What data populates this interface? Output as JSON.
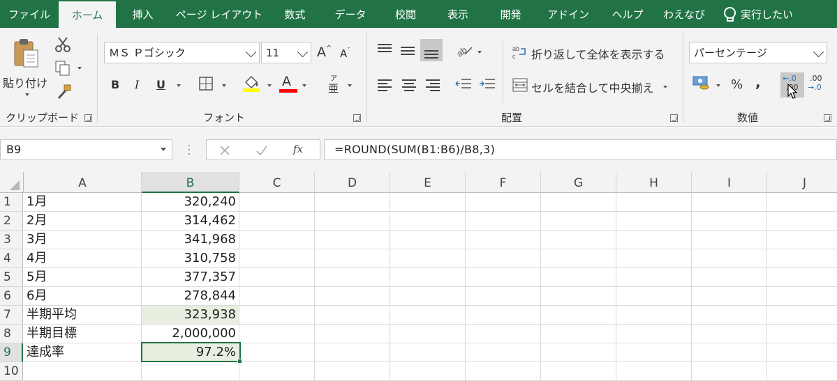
{
  "tabs": [
    {
      "label": "ファイル",
      "active": false
    },
    {
      "label": "ホーム",
      "active": true
    },
    {
      "label": "挿入",
      "active": false
    },
    {
      "label": "ページ レイアウト",
      "active": false
    },
    {
      "label": "数式",
      "active": false
    },
    {
      "label": "データ",
      "active": false
    },
    {
      "label": "校閲",
      "active": false
    },
    {
      "label": "表示",
      "active": false
    },
    {
      "label": "開発",
      "active": false
    },
    {
      "label": "アドイン",
      "active": false
    },
    {
      "label": "ヘルプ",
      "active": false
    },
    {
      "label": "わえなび",
      "active": false
    }
  ],
  "tell_me": "実行したい",
  "ribbon": {
    "clipboard": {
      "paste_label": "貼り付け",
      "group_label": "クリップボード"
    },
    "font": {
      "font_name": "ＭＳ Ｐゴシック",
      "font_size": "11",
      "grow_label": "A",
      "shrink_label": "A",
      "bold": "B",
      "italic": "I",
      "underline": "U",
      "font_color_letter": "A",
      "font_color": "#ff0000",
      "phonetic_top": "ア",
      "phonetic_bottom": "亜",
      "group_label": "フォント"
    },
    "alignment": {
      "wrap_text": "折り返して全体を表示する",
      "merge_center": "セルを結合して中央揃え",
      "group_label": "配置"
    },
    "number": {
      "format": "パーセンテージ",
      "percent": "%",
      "comma": ",",
      "increase_decimal_top": "←.0",
      "increase_decimal_bottom": ".00",
      "decrease_decimal_top": ".00",
      "decrease_decimal_bottom": "→.0",
      "group_label": "数値"
    }
  },
  "formula_bar": {
    "name_box": "B9",
    "fx": "fx",
    "formula": "=ROUND(SUM(B1:B6)/B8,3)"
  },
  "columns": [
    "A",
    "B",
    "C",
    "D",
    "E",
    "F",
    "G",
    "H",
    "I",
    "J"
  ],
  "rows": [
    {
      "num": "1",
      "a": "1月",
      "b": "320,240"
    },
    {
      "num": "2",
      "a": "2月",
      "b": "314,462"
    },
    {
      "num": "3",
      "a": "3月",
      "b": "341,968"
    },
    {
      "num": "4",
      "a": "4月",
      "b": "310,758"
    },
    {
      "num": "5",
      "a": "5月",
      "b": "377,357"
    },
    {
      "num": "6",
      "a": "6月",
      "b": "278,844"
    },
    {
      "num": "7",
      "a": "半期平均",
      "b": "323,938"
    },
    {
      "num": "8",
      "a": "半期目標",
      "b": "2,000,000"
    },
    {
      "num": "9",
      "a": "達成率",
      "b": "97.2%"
    },
    {
      "num": "10",
      "a": "",
      "b": ""
    }
  ],
  "colors": {
    "excel_green": "#217346",
    "selection_fill": "#e8eee0"
  }
}
